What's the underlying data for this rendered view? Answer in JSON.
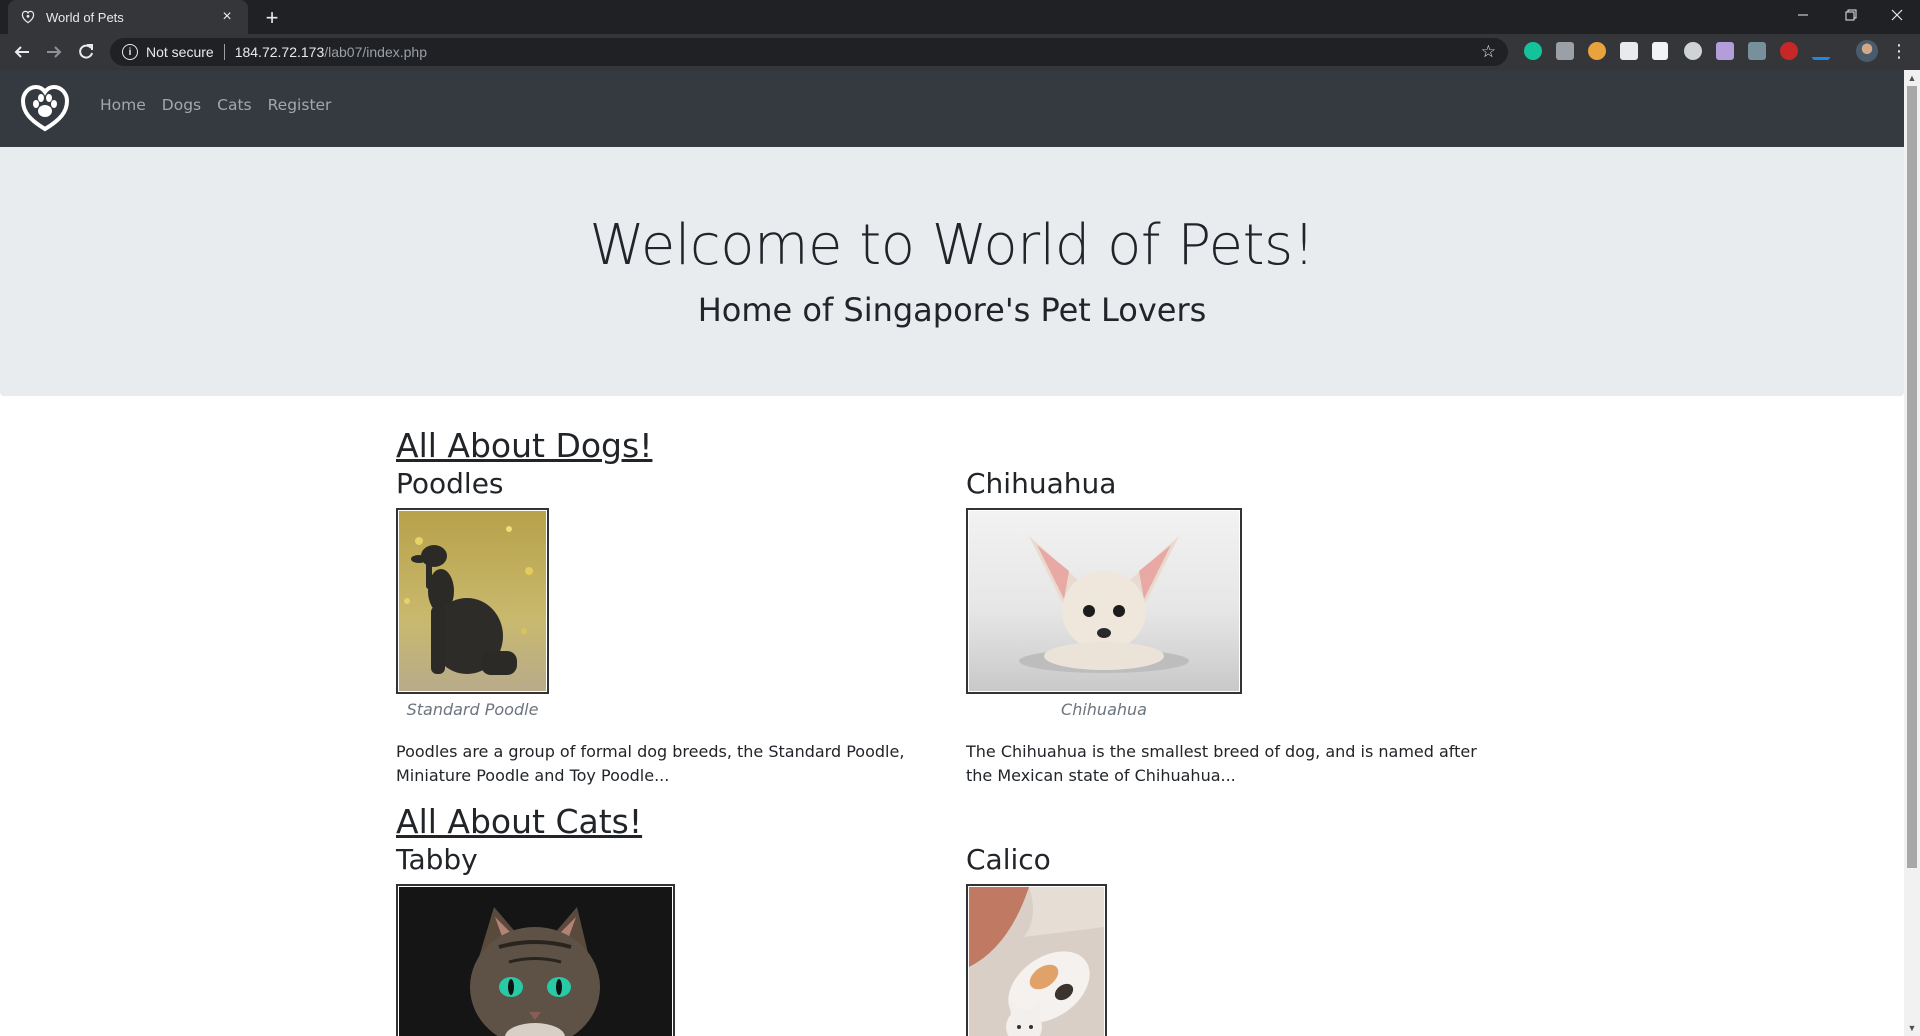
{
  "browser": {
    "tab_title": "World of Pets",
    "tab_close": "×",
    "new_tab": "+",
    "security_label": "Not secure",
    "url_host": "184.72.72.173",
    "url_path": "/lab07/index.php"
  },
  "nav": {
    "links": [
      "Home",
      "Dogs",
      "Cats",
      "Register"
    ]
  },
  "hero": {
    "title": "Welcome to World of Pets!",
    "subtitle": "Home of Singapore's Pet Lovers"
  },
  "dogs": {
    "heading": "All About Dogs!",
    "items": [
      {
        "name": "Poodles",
        "caption": "Standard Poodle",
        "description": "Poodles are a group of formal dog breeds, the Standard Poodle, Miniature Poodle and Toy Poodle..."
      },
      {
        "name": "Chihuahua",
        "caption": "Chihuahua",
        "description": "The Chihuahua is the smallest breed of dog, and is named after the Mexican state of Chihuahua..."
      }
    ]
  },
  "cats": {
    "heading": "All About Cats!",
    "items": [
      {
        "name": "Tabby"
      },
      {
        "name": "Calico"
      }
    ]
  }
}
